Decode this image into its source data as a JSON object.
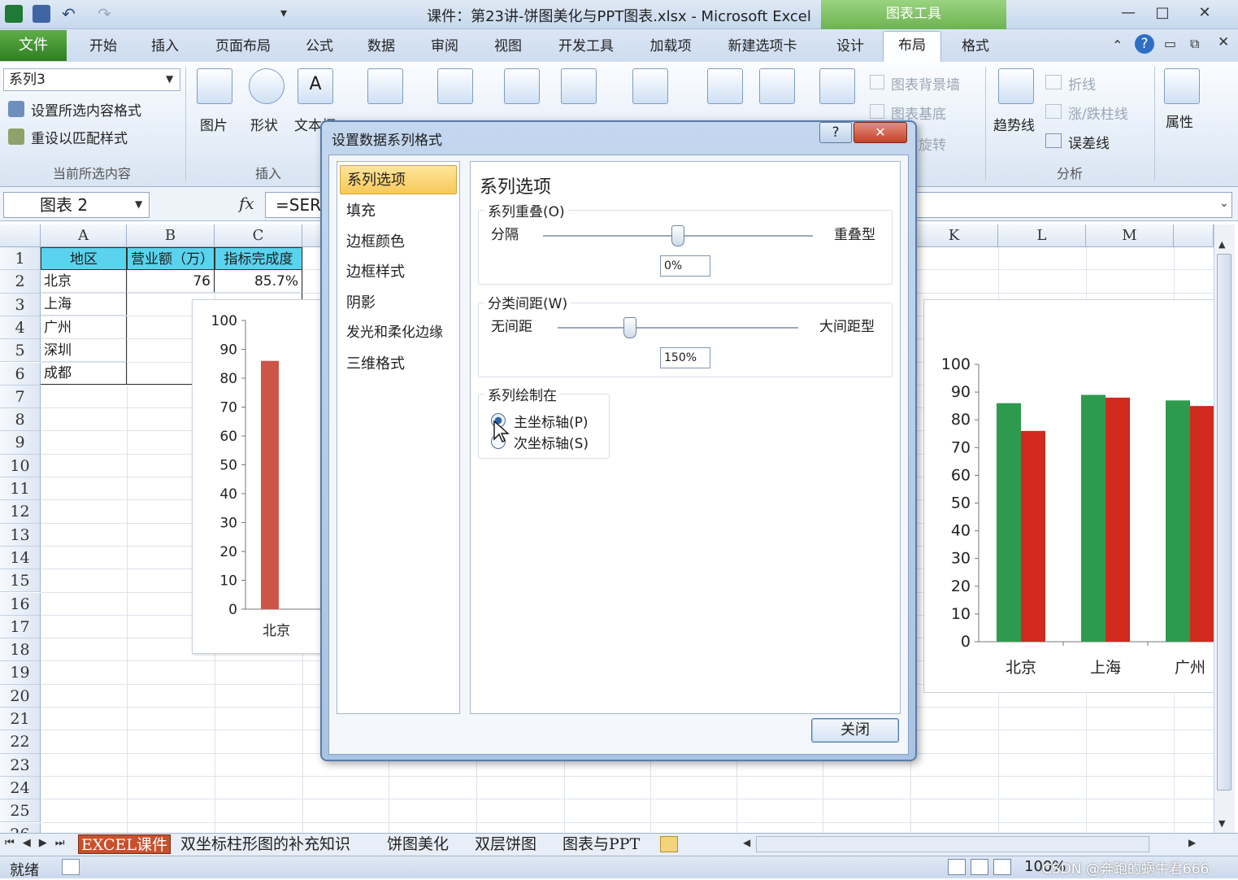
{
  "window": {
    "title": "课件：第23讲-饼图美化与PPT图表.xlsx - Microsoft Excel",
    "context_tab_group": "图表工具",
    "controls": [
      "—",
      "□",
      "✕"
    ]
  },
  "tabs": [
    "文件",
    "开始",
    "插入",
    "页面布局",
    "公式",
    "数据",
    "审阅",
    "视图",
    "开发工具",
    "加载项",
    "新建选项卡",
    "设计",
    "布局",
    "格式"
  ],
  "active_tab": "布局",
  "ribbon": {
    "selection_dropdown": "系列3",
    "format_selection": "设置所选内容格式",
    "reset_style": "重设以匹配样式",
    "group_current": "当前所选内容",
    "picture": "图片",
    "shapes": "形状",
    "textbox": "文本框",
    "group_insert": "插入",
    "chart_wall": "图表背景墙",
    "chart_floor": "图表基底",
    "rotate": "旋转",
    "trendline": "趋势线",
    "lines": "折线",
    "updown_bars": "涨/跌柱线",
    "error_bars": "误差线",
    "group_analysis": "分析",
    "properties": "属性"
  },
  "formula_bar": {
    "name_box": "图表 2",
    "fx": "fx",
    "formula": "=SER"
  },
  "columns": [
    "A",
    "B",
    "C",
    "K",
    "L",
    "M"
  ],
  "rows": [
    "1",
    "2",
    "3",
    "4",
    "5",
    "6",
    "7",
    "8",
    "9",
    "10",
    "11",
    "12",
    "13",
    "14",
    "15",
    "16",
    "17",
    "18",
    "19",
    "20",
    "21",
    "22",
    "23",
    "24",
    "25",
    "26"
  ],
  "table": {
    "headers": [
      "地区",
      "营业额（万）",
      "指标完成度"
    ],
    "regions": [
      "北京",
      "上海",
      "广州",
      "深圳",
      "成都"
    ],
    "b2": "76",
    "c2": "85.7%"
  },
  "dialog": {
    "title": "设置数据系列格式",
    "help": "?",
    "close_x": "✕",
    "nav": [
      "系列选项",
      "填充",
      "边框颜色",
      "边框样式",
      "阴影",
      "发光和柔化边缘",
      "三维格式"
    ],
    "heading": "系列选项",
    "overlap": {
      "title": "系列重叠(O)",
      "left": "分隔",
      "right": "重叠型",
      "value": "0%",
      "level": 0.5
    },
    "gap": {
      "title": "分类间距(W)",
      "left": "无间距",
      "right": "大间距型",
      "value": "150%",
      "level": 0.3
    },
    "plot_on": {
      "title": "系列绘制在",
      "primary": "主坐标轴(P)",
      "secondary": "次坐标轴(S)",
      "selected": "primary"
    },
    "close_button": "关闭"
  },
  "chart_data": [
    {
      "type": "bar",
      "categories": [
        "北京"
      ],
      "series": [
        {
          "values": [
            86
          ]
        }
      ],
      "ylim": [
        0,
        100
      ],
      "yticks": [
        "100",
        "90",
        "80",
        "70",
        "60",
        "50",
        "40",
        "30",
        "20",
        "10",
        "0"
      ]
    },
    {
      "type": "bar",
      "categories": [
        "北京",
        "上海",
        "广州"
      ],
      "series": [
        {
          "values": [
            86,
            89,
            87
          ]
        },
        {
          "values": [
            76,
            88,
            85
          ]
        }
      ],
      "ylim": [
        0,
        100
      ],
      "yticks": [
        "100",
        "90",
        "80",
        "70",
        "60",
        "50",
        "40",
        "30",
        "20",
        "10",
        "0"
      ]
    }
  ],
  "sheet_tabs": [
    "EXCEL课件",
    "双坐标柱形图的补充知识",
    "饼图美化",
    "双层饼图",
    "图表与PPT"
  ],
  "status": {
    "ready": "就绪",
    "zoom": "100%",
    "watermark": "CSDN @奔跑的蜗牛君666"
  },
  "colors": {
    "header_fill": "#5ad3ee",
    "bar_red": "#d02a1e",
    "bar_green": "#2e9a4e",
    "bar_left": "#cc5548",
    "file_tab": "#2f7e22",
    "nav_selected": "#f8c85a"
  }
}
